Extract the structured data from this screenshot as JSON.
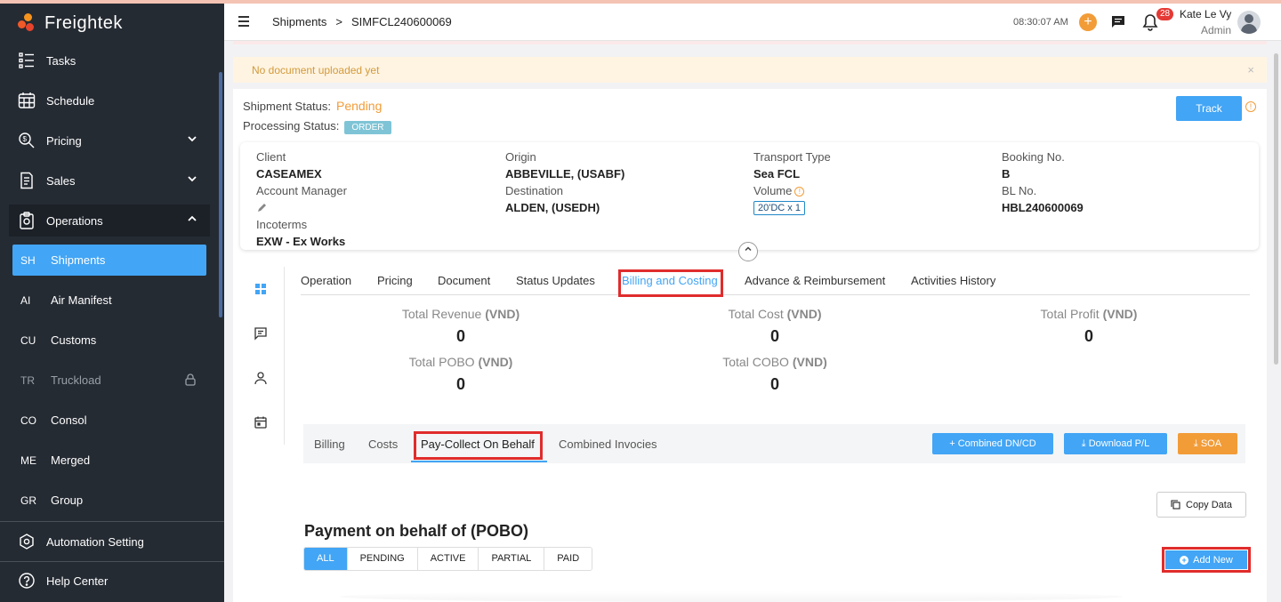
{
  "app": {
    "name": "Freightek"
  },
  "sidebar": {
    "items": [
      {
        "label": "Tasks",
        "icon": "tasks-icon"
      },
      {
        "label": "Schedule",
        "icon": "calendar-icon"
      },
      {
        "label": "Pricing",
        "icon": "pricing-icon"
      },
      {
        "label": "Sales",
        "icon": "sales-icon"
      },
      {
        "label": "Operations",
        "icon": "operations-icon"
      }
    ],
    "sub_items": [
      {
        "abbr": "SH",
        "label": "Shipments"
      },
      {
        "abbr": "AI",
        "label": "Air Manifest"
      },
      {
        "abbr": "CU",
        "label": "Customs"
      },
      {
        "abbr": "TR",
        "label": "Truckload"
      },
      {
        "abbr": "CO",
        "label": "Consol"
      },
      {
        "abbr": "ME",
        "label": "Merged"
      },
      {
        "abbr": "GR",
        "label": "Group"
      }
    ],
    "bottom": [
      {
        "label": "Automation Setting",
        "icon": "settings-icon"
      },
      {
        "label": "Help Center",
        "icon": "help-icon"
      }
    ]
  },
  "header": {
    "breadcrumb": [
      "Shipments",
      ">",
      "SIMFCL240600069"
    ],
    "time": "08:30:07 AM",
    "notification_count": "28",
    "user_name": "Kate Le Vy",
    "user_role": "Admin"
  },
  "alert": {
    "text": "No document uploaded yet",
    "close": "×"
  },
  "shipment": {
    "status_label": "Shipment Status:",
    "status_value": "Pending",
    "processing_label": "Processing Status:",
    "processing_value": "ORDER",
    "track_label": "Track"
  },
  "details": {
    "client_label": "Client",
    "client": "CASEAMEX",
    "account_manager_label": "Account Manager",
    "incoterms_label": "Incoterms",
    "incoterms": "EXW - Ex Works",
    "origin_label": "Origin",
    "origin": "ABBEVILLE, (USABF)",
    "destination_label": "Destination",
    "destination": "ALDEN, (USEDH)",
    "transport_label": "Transport Type",
    "transport": "Sea FCL",
    "volume_label": "Volume",
    "volume": "20'DC x 1",
    "booking_label": "Booking No.",
    "booking": "B",
    "bl_label": "BL No.",
    "bl": "HBL240600069"
  },
  "tabs": [
    "Operation",
    "Pricing",
    "Document",
    "Status Updates",
    "Billing and Costing",
    "Advance & Reimbursement",
    "Activities History"
  ],
  "totals": {
    "revenue_label": "Total Revenue",
    "revenue": "0",
    "cost_label": "Total Cost",
    "cost": "0",
    "profit_label": "Total Profit",
    "profit": "0",
    "pobo_label": "Total POBO",
    "pobo": "0",
    "cobo_label": "Total COBO",
    "cobo": "0",
    "currency": "(VND)"
  },
  "subtabs": [
    "Billing",
    "Costs",
    "Pay-Collect On Behalf",
    "Combined Invocies"
  ],
  "actions": {
    "combined": "Combined DN/CD",
    "download": "Download P/L",
    "soa": "SOA"
  },
  "pobo": {
    "copy_label": "Copy Data",
    "title": "Payment on behalf of (POBO)",
    "filters": [
      "ALL",
      "PENDING",
      "ACTIVE",
      "PARTIAL",
      "PAID"
    ],
    "add_label": "Add New"
  },
  "colors": {
    "accent": "#42a5f5",
    "sidebar": "#252b33",
    "warning": "#f29c38",
    "highlight": "#e02c2c"
  }
}
